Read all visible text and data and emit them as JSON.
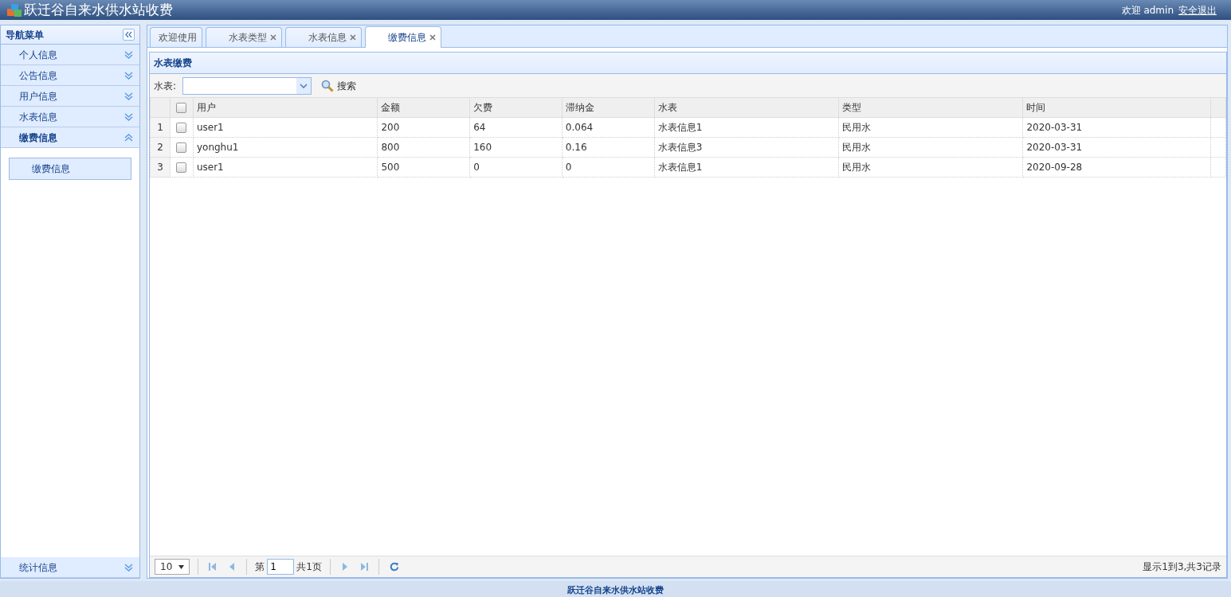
{
  "header": {
    "title": "跃迁谷自来水供水站收费",
    "welcome": "欢迎 admin",
    "logout": "安全退出"
  },
  "sidebar": {
    "title": "导航菜单",
    "groups": [
      {
        "label": "个人信息",
        "expanded": false
      },
      {
        "label": "公告信息",
        "expanded": false
      },
      {
        "label": "用户信息",
        "expanded": false
      },
      {
        "label": "水表信息",
        "expanded": false
      },
      {
        "label": "缴费信息",
        "expanded": true,
        "children": [
          {
            "label": "缴费信息"
          }
        ]
      }
    ],
    "bottom_groups": [
      {
        "label": "统计信息",
        "expanded": false
      }
    ]
  },
  "tabs": [
    {
      "label": "欢迎使用",
      "closable": false,
      "selected": false
    },
    {
      "label": "水表类型",
      "closable": true,
      "selected": false
    },
    {
      "label": "水表信息",
      "closable": true,
      "selected": false
    },
    {
      "label": "缴费信息",
      "closable": true,
      "selected": true
    }
  ],
  "panel": {
    "title": "水表缴费",
    "filter_label": "水表:",
    "search": "搜索"
  },
  "table": {
    "all_checked": false,
    "columns": [
      "用户",
      "金额",
      "欠费",
      "滞纳金",
      "水表",
      "类型",
      "时间"
    ],
    "rows": [
      {
        "index": "1",
        "checked": false,
        "cells": [
          "user1",
          "200",
          "64",
          "0.064",
          "水表信息1",
          "民用水",
          "2020-03-31"
        ]
      },
      {
        "index": "2",
        "checked": false,
        "cells": [
          "yonghu1",
          "800",
          "160",
          "0.16",
          "水表信息3",
          "民用水",
          "2020-03-31"
        ]
      },
      {
        "index": "3",
        "checked": false,
        "cells": [
          "user1",
          "500",
          "0",
          "0",
          "水表信息1",
          "民用水",
          "2020-09-28"
        ]
      }
    ]
  },
  "pager": {
    "page_size": "10",
    "page_prefix": "第",
    "page": "1",
    "page_total": "共1页",
    "info": "显示1到3,共3记录"
  },
  "footer": {
    "text": "跃迁谷自来水供水站收费"
  }
}
